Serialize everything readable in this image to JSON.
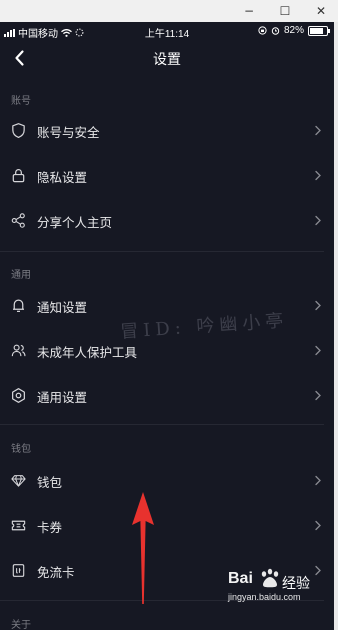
{
  "window": {
    "minimize_glyph": "−",
    "maximize_glyph": "☐",
    "close_glyph": "✕"
  },
  "status_bar": {
    "carrier": "中国移动",
    "time": "上午11:14",
    "battery_percent": "82%",
    "battery_level": 0.82
  },
  "header": {
    "title": "设置",
    "back_icon": "chevron-left-icon"
  },
  "sections": [
    {
      "label": "账号",
      "items": [
        {
          "label": "账号与安全",
          "icon": "shield-icon"
        },
        {
          "label": "隐私设置",
          "icon": "lock-icon"
        },
        {
          "label": "分享个人主页",
          "icon": "share-icon"
        }
      ]
    },
    {
      "label": "通用",
      "items": [
        {
          "label": "通知设置",
          "icon": "bell-icon"
        },
        {
          "label": "未成年人保护工具",
          "icon": "users-icon"
        },
        {
          "label": "通用设置",
          "icon": "gear-icon"
        }
      ]
    },
    {
      "label": "钱包",
      "items": [
        {
          "label": "钱包",
          "icon": "diamond-icon"
        },
        {
          "label": "卡券",
          "icon": "ticket-icon"
        },
        {
          "label": "免流卡",
          "icon": "sim-card-icon"
        }
      ]
    },
    {
      "label": "关于",
      "items": []
    }
  ],
  "watermark_text": "冒ID: 吟幽小亭",
  "baidu_logo": {
    "wordmark": "Bai",
    "cn": "经验",
    "url": "jingyan.baidu.com"
  },
  "colors": {
    "background": "#161823",
    "text": "#e8e8ea",
    "section_label": "#7b7c84",
    "arrow": "#e8322e"
  }
}
